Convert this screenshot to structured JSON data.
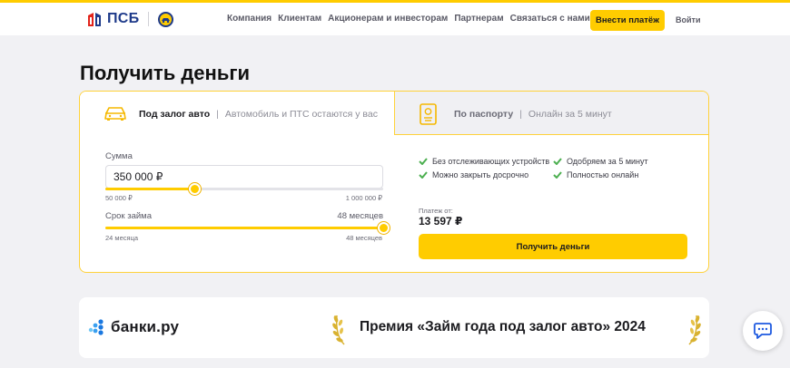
{
  "header": {
    "logo_text": "ПСБ",
    "nav": [
      "Компания",
      "Клиентам",
      "Акционерам и инвесторам",
      "Партнерам",
      "Связаться с нами"
    ],
    "pay_button": "Внести платёж",
    "login": "Войти"
  },
  "page": {
    "title": "Получить деньги"
  },
  "tabs": {
    "auto": {
      "label": "Под залог авто",
      "sub": "Автомобиль и ПТС остаются у вас"
    },
    "passport": {
      "label": "По паспорту",
      "sub": "Онлайн за 5 минут"
    }
  },
  "calculator": {
    "amount_label": "Сумма",
    "amount_value": "350 000 ₽",
    "amount_min": "50 000 ₽",
    "amount_max": "1 000 000 ₽",
    "amount_fraction": 0.32,
    "term_label": "Срок займа",
    "term_value": "48 месяцев",
    "term_min": "24 месяца",
    "term_max": "48 месяцев",
    "term_fraction": 1.0
  },
  "features": [
    "Без отслеживающих устройств",
    "Одобряем за 5 минут",
    "Можно закрыть досрочно",
    "Полностью онлайн"
  ],
  "payment": {
    "label": "Платеж от:",
    "value": "13 597 ₽"
  },
  "cta": "Получить деньги",
  "banner": {
    "brand": "банки.ру",
    "award": "Премия «Займ года под залог авто» 2024"
  },
  "colors": {
    "accent": "#ffcc00",
    "brand_blue": "#1e3a8a",
    "check_green": "#4caf50"
  }
}
